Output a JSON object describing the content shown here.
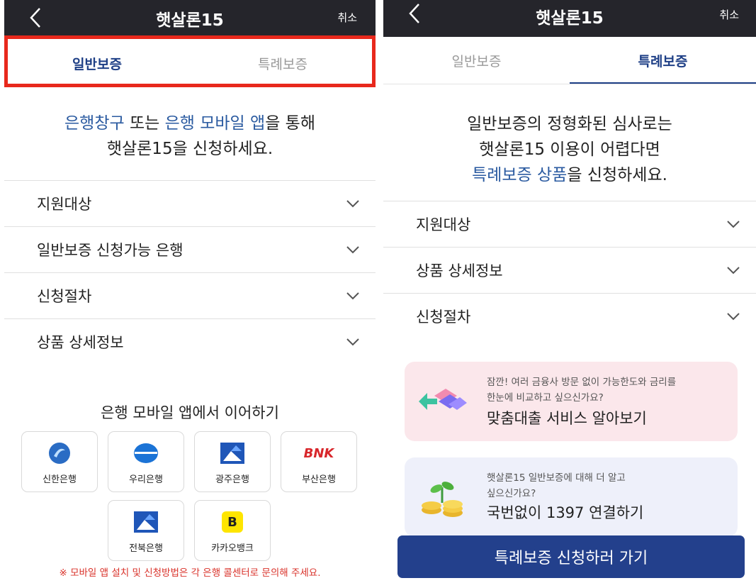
{
  "left": {
    "header": {
      "title": "햇살론15",
      "cancel": "취소"
    },
    "tabs": [
      "일반보증",
      "특례보증"
    ],
    "intro": {
      "line1_em1": "은행창구",
      "line1_mid": " 또는 ",
      "line1_em2": "은행 모바일 앱",
      "line1_end": "을 통해",
      "line2": "햇살론15을 신청하세요."
    },
    "accordion": [
      "지원대상",
      "일반보증 신청가능 은행",
      "신청절차",
      "상품 상세정보"
    ],
    "continue_title": "은행 모바일 앱에서 이어하기",
    "banks": [
      {
        "name": "신한은행",
        "icon": "shinhan-logo-icon"
      },
      {
        "name": "우리은행",
        "icon": "woori-logo-icon"
      },
      {
        "name": "광주은행",
        "icon": "kwangju-logo-icon"
      },
      {
        "name": "부산은행",
        "icon": "bnk-logo-icon",
        "logo_text": "BNK"
      },
      {
        "name": "전북은행",
        "icon": "jeonbuk-logo-icon"
      },
      {
        "name": "카카오뱅크",
        "icon": "kakaobank-logo-icon",
        "logo_text": "B"
      }
    ],
    "notice": "※ 모바일 앱 설치 및 신청방법은 각 은행 콜센터로 문의해 주세요."
  },
  "right": {
    "header": {
      "title": "햇살론15",
      "cancel": "취소"
    },
    "tabs": [
      "일반보증",
      "특례보증"
    ],
    "intro": {
      "line1": "일반보증의 정형화된 심사로는",
      "line2": "햇살론15 이용이 어렵다면",
      "line3_em": "특례보증 상품",
      "line3_end": "을 신청하세요."
    },
    "accordion": [
      "지원대상",
      "상품 상세정보",
      "신청절차"
    ],
    "card1": {
      "small1": "잠깐! 여러 금융사 방문 없이 가능한도와 금리를",
      "small2": "한눈에 비교하고 싶으신가요?",
      "big": "맞춤대출 서비스 알아보기"
    },
    "card2": {
      "small1": "햇살론15 일반보증에 대해 더 알고",
      "small2": "싶으신가요?",
      "big": "국번없이 1397 연결하기"
    },
    "cta": "특례보증 신청하러 가기"
  },
  "colors": {
    "header_bg": "#25252b",
    "accent": "#1e3f86",
    "highlight": "#e8281c",
    "cta_bg": "#23408c",
    "notice": "#d9322a"
  }
}
